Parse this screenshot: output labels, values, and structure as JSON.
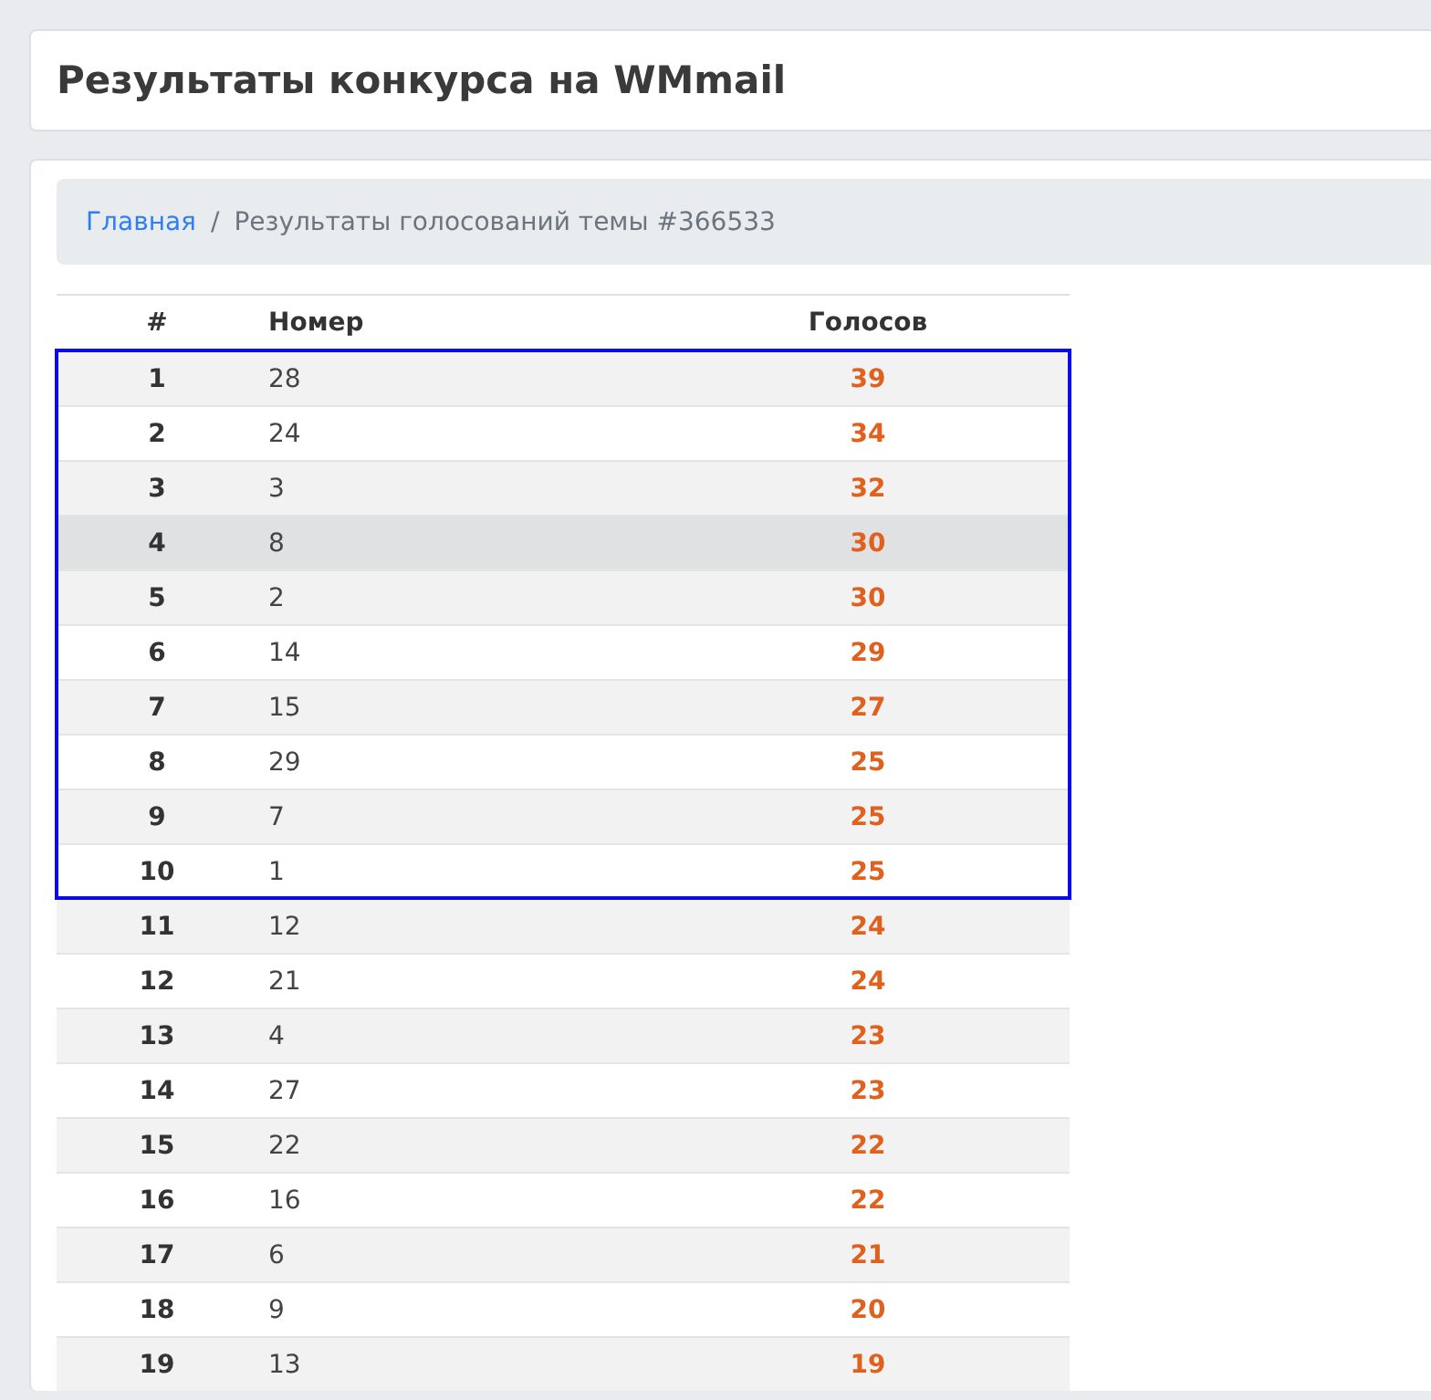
{
  "page_title": "Результаты конкурса на WMmail",
  "breadcrumb": {
    "separator": "/",
    "items": [
      {
        "label": "Главная",
        "kind": "link"
      },
      {
        "label": "Результаты голосований темы #366533",
        "kind": "current"
      }
    ]
  },
  "table": {
    "columns": [
      "#",
      "Номер",
      "Голосов"
    ],
    "framed_rows": [
      {
        "rank": "1",
        "number": "28",
        "votes": "39",
        "hovered": false
      },
      {
        "rank": "2",
        "number": "24",
        "votes": "34",
        "hovered": false
      },
      {
        "rank": "3",
        "number": "3",
        "votes": "32",
        "hovered": false
      },
      {
        "rank": "4",
        "number": "8",
        "votes": "30",
        "hovered": true
      },
      {
        "rank": "5",
        "number": "2",
        "votes": "30",
        "hovered": false
      },
      {
        "rank": "6",
        "number": "14",
        "votes": "29",
        "hovered": false
      },
      {
        "rank": "7",
        "number": "15",
        "votes": "27",
        "hovered": false
      },
      {
        "rank": "8",
        "number": "29",
        "votes": "25",
        "hovered": false
      },
      {
        "rank": "9",
        "number": "7",
        "votes": "25",
        "hovered": false
      },
      {
        "rank": "10",
        "number": "1",
        "votes": "25",
        "hovered": false
      }
    ],
    "rows": [
      {
        "rank": "11",
        "number": "12",
        "votes": "24",
        "hovered": false
      },
      {
        "rank": "12",
        "number": "21",
        "votes": "24",
        "hovered": false
      },
      {
        "rank": "13",
        "number": "4",
        "votes": "23",
        "hovered": false
      },
      {
        "rank": "14",
        "number": "27",
        "votes": "23",
        "hovered": false
      },
      {
        "rank": "15",
        "number": "22",
        "votes": "22",
        "hovered": false
      },
      {
        "rank": "16",
        "number": "16",
        "votes": "22",
        "hovered": false
      },
      {
        "rank": "17",
        "number": "6",
        "votes": "21",
        "hovered": false
      },
      {
        "rank": "18",
        "number": "9",
        "votes": "20",
        "hovered": false
      },
      {
        "rank": "19",
        "number": "13",
        "votes": "19",
        "hovered": false
      }
    ]
  }
}
